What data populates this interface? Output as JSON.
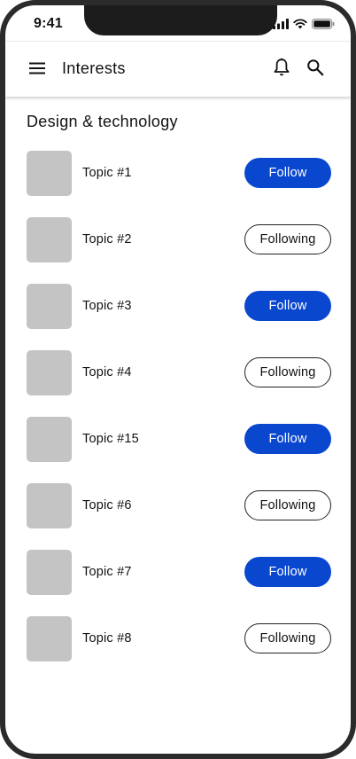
{
  "status_bar": {
    "time": "9:41",
    "icons": [
      "cellular-signal-icon",
      "wifi-icon",
      "battery-icon"
    ]
  },
  "top_bar": {
    "title": "Interests",
    "menu_icon": "hamburger-menu-icon",
    "notifications_icon": "bell-icon",
    "search_icon": "search-icon"
  },
  "section": {
    "title": "Design & technology"
  },
  "topics": [
    {
      "name": "Topic #1",
      "button_label": "Follow",
      "state": "follow"
    },
    {
      "name": "Topic #2",
      "button_label": "Following",
      "state": "following"
    },
    {
      "name": "Topic #3",
      "button_label": "Follow",
      "state": "follow"
    },
    {
      "name": "Topic #4",
      "button_label": "Following",
      "state": "following"
    },
    {
      "name": "Topic #15",
      "button_label": "Follow",
      "state": "follow"
    },
    {
      "name": "Topic #6",
      "button_label": "Following",
      "state": "following"
    },
    {
      "name": "Topic #7",
      "button_label": "Follow",
      "state": "follow"
    },
    {
      "name": "Topic #8",
      "button_label": "Following",
      "state": "following"
    }
  ],
  "colors": {
    "accent": "#0a47cf",
    "thumbnail": "#c4c4c4",
    "frame": "#2b2b2b"
  }
}
